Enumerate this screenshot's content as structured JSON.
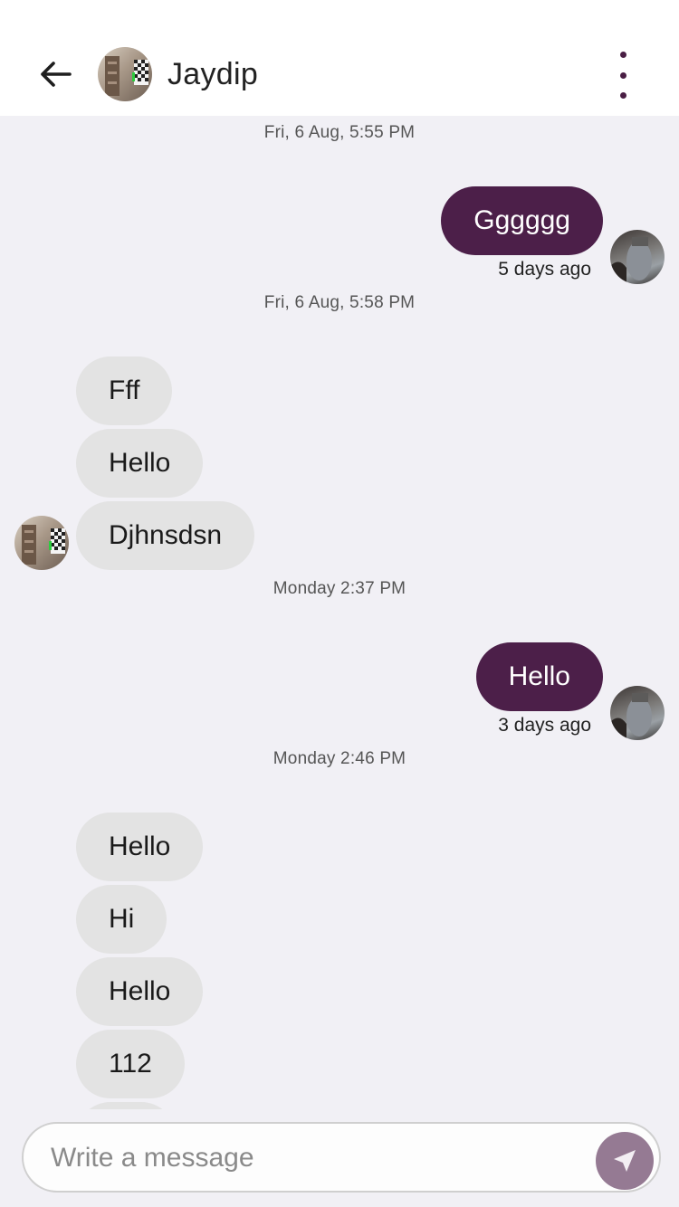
{
  "header": {
    "contact_name": "Jaydip",
    "back_icon": "arrow-left-icon",
    "menu_icon": "more-vertical-icon"
  },
  "colors": {
    "sent_bubble": "#4c1f49",
    "received_bubble": "#e3e3e3",
    "background": "#f1f0f5",
    "send_button": "#957a93",
    "status_indicator": "#e05a47"
  },
  "messages": {
    "timestamps": [
      "Fri, 6 Aug, 5:55 PM",
      "Fri, 6 Aug, 5:58 PM",
      "Monday 2:37 PM",
      "Monday 2:46 PM"
    ],
    "sent": [
      {
        "text": "Gggggg",
        "time": "5 days ago"
      },
      {
        "text": "Hello",
        "time": "3 days ago"
      }
    ],
    "received_group_1": [
      "Fff",
      "Hello",
      "Djhnsdsn"
    ],
    "received_group_2": [
      "Hello",
      "Hi",
      "Hello",
      "112"
    ]
  },
  "composer": {
    "placeholder": "Write a message",
    "send_icon": "send-icon"
  }
}
